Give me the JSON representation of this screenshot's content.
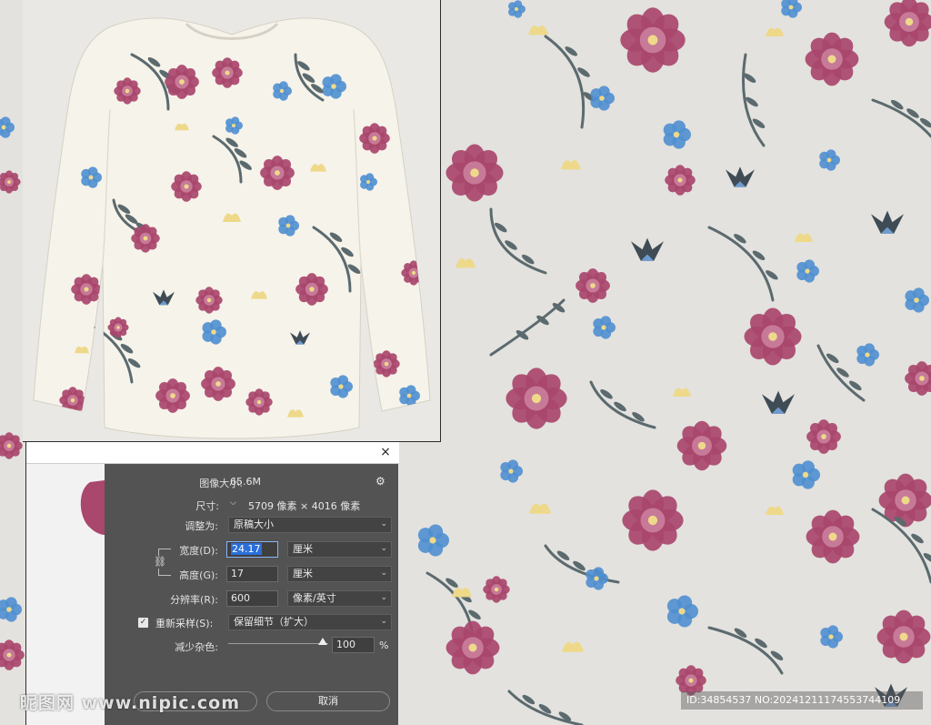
{
  "colors": {
    "background": "#e3e2de",
    "flower_pink": "#a9476d",
    "flower_blue": "#4f8fd0",
    "flower_yellow": "#eed98a",
    "stem": "#5b6a6e",
    "dialog_bg": "#535353",
    "selection": "#2a6fdb"
  },
  "dialog": {
    "close_icon": "×",
    "image_size_label": "图像大小:",
    "image_size_value": "65.6M",
    "gear_icon": "⚙",
    "dimensions_label": "尺寸:",
    "dimensions_value": "5709 像素 × 4016 像素",
    "fit_to_label": "调整为:",
    "fit_to_value": "原稿大小",
    "width_label": "宽度(D):",
    "width_value": "24.17",
    "width_unit": "厘米",
    "height_label": "高度(G):",
    "height_value": "17",
    "height_unit": "厘米",
    "resolution_label": "分辨率(R):",
    "resolution_value": "600",
    "resolution_unit": "像素/英寸",
    "resample_label": "重新采样(S):",
    "resample_checked": true,
    "resample_value": "保留细节（扩大）",
    "noise_label": "减少杂色:",
    "noise_value": "100",
    "noise_unit": "%",
    "noise_level": 1.0,
    "ok_label": "",
    "cancel_label": "取消"
  },
  "watermark": {
    "left": "昵图网 www.nipic.com",
    "right": "ID:34854537 NO:20241211174553744109"
  }
}
